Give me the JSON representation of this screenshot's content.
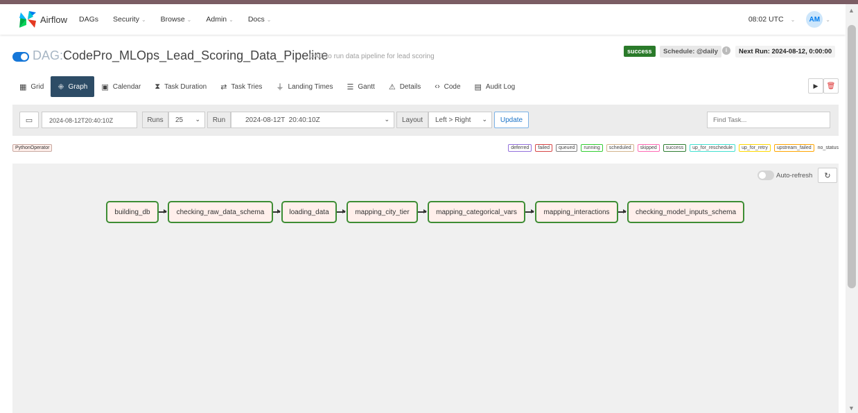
{
  "nav": {
    "brand": "Airflow",
    "items": [
      "DAGs",
      "Security",
      "Browse",
      "Admin",
      "Docs"
    ],
    "clock": "08:02 UTC",
    "avatar": "AM"
  },
  "dag": {
    "prefix": "DAG:",
    "id": "CodePro_MLOps_Lead_Scoring_Data_Pipeline",
    "description": "DAG to run data pipeline for lead scoring",
    "status": "success",
    "schedule": "Schedule: @daily",
    "next_run": "Next Run: 2024-08-12, 0:00:00"
  },
  "tabs": [
    "Grid",
    "Graph",
    "Calendar",
    "Task Duration",
    "Task Tries",
    "Landing Times",
    "Gantt",
    "Details",
    "Code",
    "Audit Log"
  ],
  "filters": {
    "base_date": "2024-08-12T20:40:10Z",
    "runs_label": "Runs",
    "runs_value": "25",
    "run_label": "Run",
    "run_value": "2024-08-12T  20:40:10Z",
    "layout_label": "Layout",
    "layout_value": "Left > Right",
    "update_label": "Update",
    "find_placeholder": "Find Task..."
  },
  "operator": "PythonOperator",
  "legend": [
    {
      "label": "deferred",
      "color": "#9370db"
    },
    {
      "label": "failed",
      "color": "#d64545"
    },
    {
      "label": "queued",
      "color": "#808080"
    },
    {
      "label": "running",
      "color": "#32cd32"
    },
    {
      "label": "scheduled",
      "color": "#d2b48c"
    },
    {
      "label": "skipped",
      "color": "#ff69b4"
    },
    {
      "label": "success",
      "color": "#2e7d32"
    },
    {
      "label": "up_for_reschedule",
      "color": "#40e0d0"
    },
    {
      "label": "up_for_retry",
      "color": "#ffd700"
    },
    {
      "label": "upstream_failed",
      "color": "#ffa500"
    },
    {
      "label": "no_status",
      "color": ""
    }
  ],
  "graph": {
    "autorefresh_label": "Auto-refresh",
    "tasks": [
      "building_db",
      "checking_raw_data_schema",
      "loading_data",
      "mapping_city_tier",
      "mapping_categorical_vars",
      "mapping_interactions",
      "checking_model_inputs_schema"
    ]
  },
  "icons": {
    "grid": "grid-icon",
    "graph": "graph-icon",
    "calendar": "calendar-icon",
    "duration": "hourglass-icon",
    "tries": "swap-icon",
    "landing": "landing-icon",
    "gantt": "gantt-icon",
    "details": "warning-icon",
    "code": "code-icon",
    "audit": "file-icon",
    "play": "play-icon",
    "delete": "trash-icon",
    "refresh": "refresh-icon"
  }
}
